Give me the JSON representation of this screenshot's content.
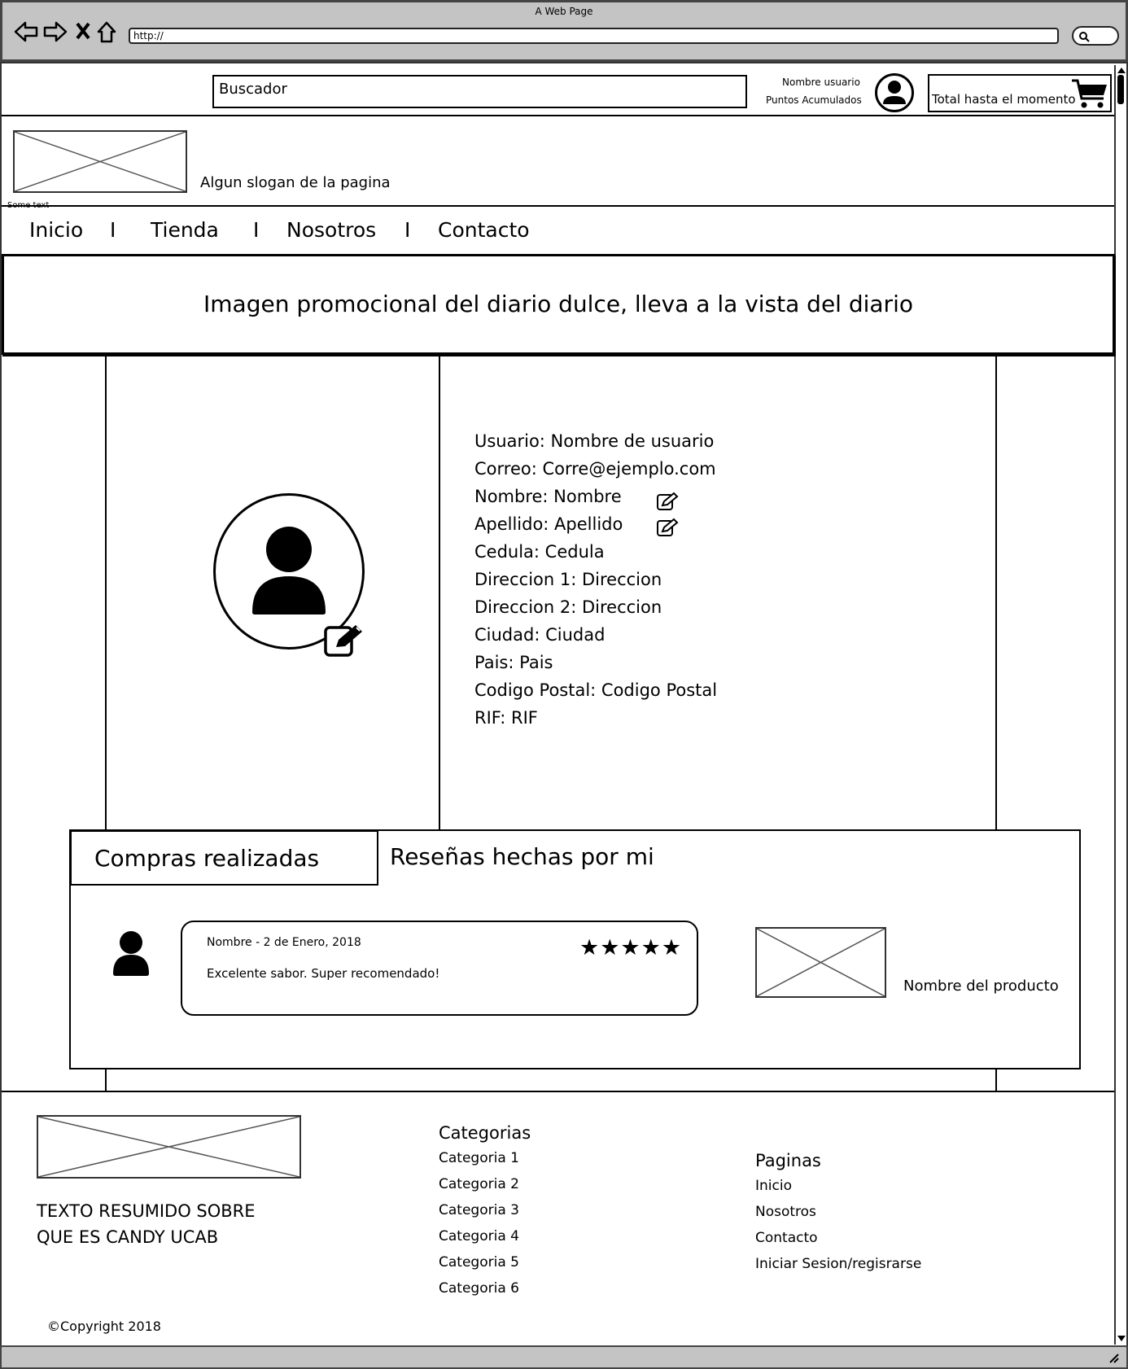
{
  "window": {
    "title": "A Web Page",
    "url": "http://"
  },
  "header": {
    "search_placeholder": "Buscador",
    "user_name": "Nombre usuario",
    "points": "Puntos Acumulados",
    "cart_total": "Total hasta el momento"
  },
  "brand": {
    "slogan": "Algun slogan de la pagina",
    "tiny_text": "Some text"
  },
  "menu": {
    "items": [
      "Inicio",
      "Tienda",
      "Nosotros",
      "Contacto"
    ],
    "separator": "I"
  },
  "promo": {
    "text": "Imagen promocional del diario dulce, lleva a la vista del diario"
  },
  "profile": {
    "fields": [
      "Usuario: Nombre de usuario",
      "Correo: Corre@ejemplo.com",
      "Nombre: Nombre",
      "Apellido: Apellido",
      "Cedula: Cedula",
      "Direccion 1: Direccion",
      "Direccion 2: Direccion",
      "Ciudad: Ciudad",
      "Pais: Pais",
      "Codigo Postal: Codigo Postal",
      "RIF: RIF"
    ]
  },
  "tabs": {
    "purchases": "Compras realizadas",
    "reviews": "Reseñas hechas por mi"
  },
  "review": {
    "header": "Nombre -  2 de Enero, 2018",
    "body": "Excelente sabor. Super recomendado!",
    "stars": "★★★★★",
    "rating": 5,
    "product_name": "Nombre del producto"
  },
  "footer": {
    "about": [
      "TEXTO RESUMIDO SOBRE",
      "QUE ES CANDY UCAB"
    ],
    "categories_title": "Categorias",
    "categories": [
      "Categoria 1",
      "Categoria 2",
      "Categoria 3",
      "Categoria 4",
      "Categoria 5",
      "Categoria 6"
    ],
    "pages_title": "Paginas",
    "pages": [
      "Inicio",
      "Nosotros",
      "Contacto",
      "Iniciar Sesion/regisrarse"
    ],
    "copyright": "©Copyright 2018"
  }
}
